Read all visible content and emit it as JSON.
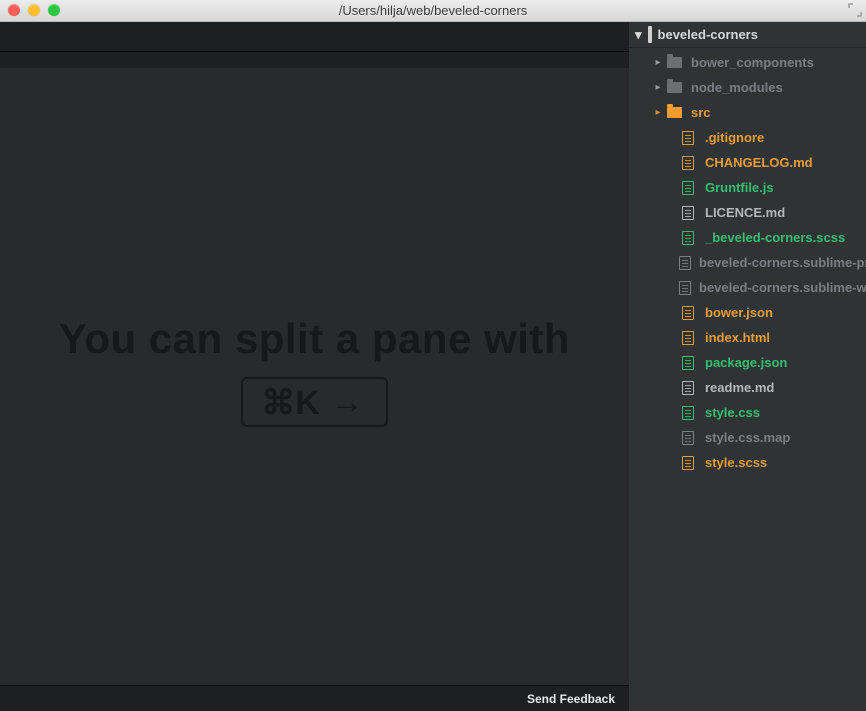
{
  "window": {
    "title": "/Users/hilja/web/beveled-corners"
  },
  "hint": {
    "text": "You can split a pane with",
    "key_combo": "⌘K",
    "key_arrow": "→"
  },
  "status": {
    "feedback": "Send Feedback"
  },
  "tree": {
    "root": "beveled-corners",
    "folders": [
      {
        "name": "bower_components"
      },
      {
        "name": "node_modules"
      },
      {
        "name": "src"
      }
    ],
    "files": [
      {
        "name": ".gitignore",
        "color": "orange"
      },
      {
        "name": "CHANGELOG.md",
        "color": "orange"
      },
      {
        "name": "Gruntfile.js",
        "color": "green"
      },
      {
        "name": "LICENCE.md",
        "color": "grey"
      },
      {
        "name": "_beveled-corners.scss",
        "color": "green"
      },
      {
        "name": "beveled-corners.sublime-project",
        "color": "dim"
      },
      {
        "name": "beveled-corners.sublime-workspace",
        "color": "dim"
      },
      {
        "name": "bower.json",
        "color": "orange"
      },
      {
        "name": "index.html",
        "color": "orange"
      },
      {
        "name": "package.json",
        "color": "green"
      },
      {
        "name": "readme.md",
        "color": "grey"
      },
      {
        "name": "style.css",
        "color": "green"
      },
      {
        "name": "style.css.map",
        "color": "dim"
      },
      {
        "name": "style.scss",
        "color": "orange"
      }
    ]
  }
}
